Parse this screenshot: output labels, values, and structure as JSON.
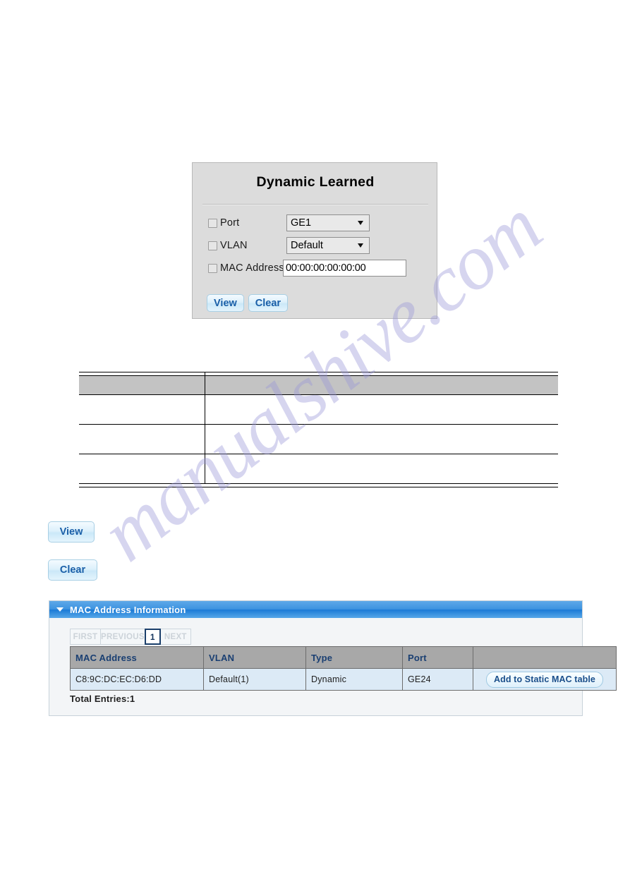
{
  "watermark": {
    "text": "manualshive.com"
  },
  "form_panel": {
    "title": "Dynamic Learned",
    "rows": [
      {
        "checkbox_label": "Port",
        "control": "select",
        "value": "GE1"
      },
      {
        "checkbox_label": "VLAN",
        "control": "select",
        "value": "Default"
      },
      {
        "checkbox_label": "MAC Address",
        "control": "text",
        "value": "00:00:00:00:00:00"
      }
    ],
    "buttons": [
      {
        "label": "View"
      },
      {
        "label": "Clear"
      }
    ]
  },
  "doc_table": {
    "header_cells": [
      "",
      ""
    ],
    "rows": [
      [
        "",
        ""
      ],
      [
        "",
        ""
      ],
      [
        "",
        ""
      ]
    ]
  },
  "standalone_buttons": {
    "view": "View",
    "clear": "Clear"
  },
  "mac_panel": {
    "title": "MAC Address Information",
    "pager": {
      "first": "FIRST",
      "previous": "PREVIOUS",
      "current_page": "1",
      "next": "NEXT"
    },
    "columns": [
      "MAC Address",
      "VLAN",
      "Type",
      "Port",
      ""
    ],
    "rows": [
      {
        "mac_address": "C8:9C:DC:EC:D6:DD",
        "vlan": "Default(1)",
        "type": "Dynamic",
        "port": "GE24",
        "action_label": "Add to Static MAC table"
      }
    ],
    "total_entries": "Total Entries:1"
  },
  "colors": {
    "panel_header_blue": "#1b7ad6",
    "panel_bg_gray": "#dcdcdc",
    "table_header_gray": "#a8a8a8",
    "row_blue": "#dceaf6",
    "link_blue": "#1a4e8a",
    "watermark_purple": "#9a97d8"
  }
}
